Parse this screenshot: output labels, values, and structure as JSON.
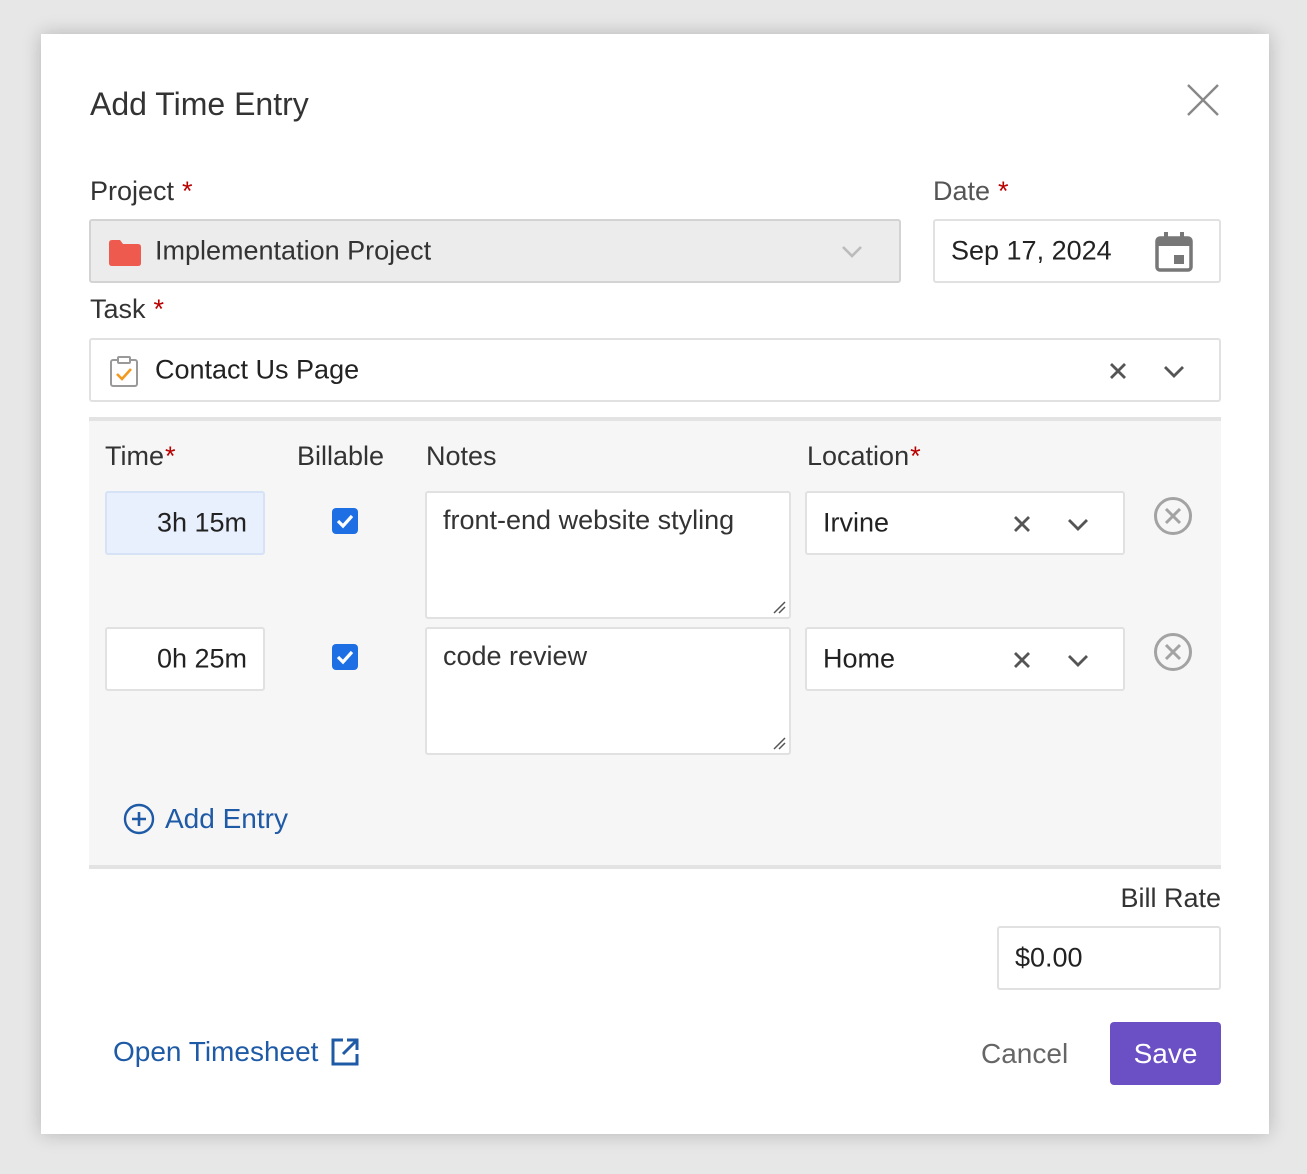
{
  "dialog": {
    "title": "Add Time Entry"
  },
  "project": {
    "label": "Project",
    "required_marker": "*",
    "value": "Implementation Project",
    "icon": "folder-icon",
    "icon_color": "#ef5a4f"
  },
  "date": {
    "label": "Date",
    "required_marker": "*",
    "value": "Sep 17, 2024",
    "icon": "calendar-icon"
  },
  "task": {
    "label": "Task",
    "required_marker": "*",
    "value": "Contact Us Page",
    "icon": "task-clipboard-icon"
  },
  "entries": {
    "columns": {
      "time": "Time",
      "billable": "Billable",
      "notes": "Notes",
      "location": "Location",
      "required_marker": "*"
    },
    "rows": [
      {
        "time": "3h 15m",
        "billable": true,
        "notes": "front-end website styling",
        "location": "Irvine"
      },
      {
        "time": "0h 25m",
        "billable": true,
        "notes": "code review",
        "location": "Home"
      }
    ],
    "add_label": "Add Entry"
  },
  "bill_rate": {
    "label": "Bill Rate",
    "value": "$0.00"
  },
  "footer": {
    "open_timesheet": "Open Timesheet",
    "cancel": "Cancel",
    "save": "Save"
  },
  "colors": {
    "accent": "#6b4fc4",
    "link": "#1f5aa6",
    "checkbox": "#1d6fe3",
    "required": "#b00000"
  }
}
